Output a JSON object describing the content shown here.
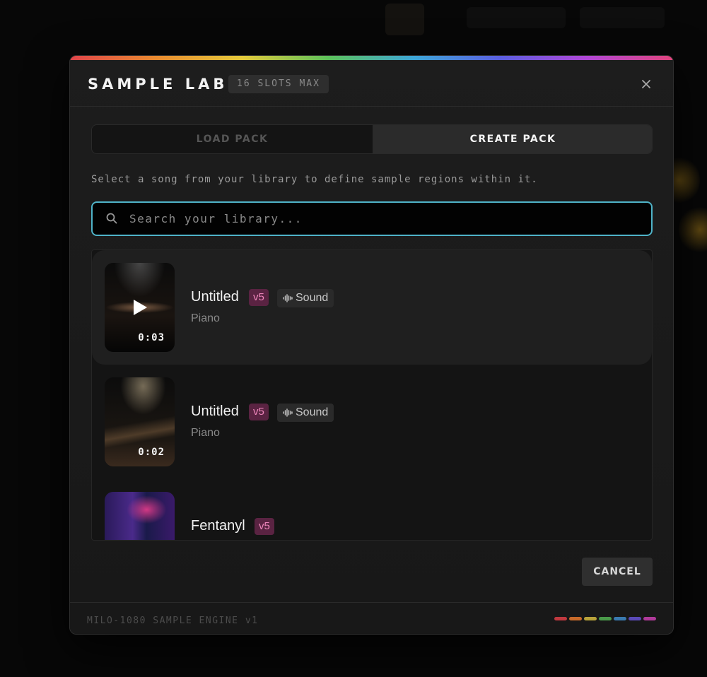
{
  "modal": {
    "title": "SAMPLE LAB",
    "slots_badge": "16 SLOTS MAX",
    "close_icon": "close-icon"
  },
  "tabs": [
    {
      "label": "LOAD PACK",
      "active": false
    },
    {
      "label": "CREATE PACK",
      "active": true
    }
  ],
  "hint": "Select a song from your library to define sample regions within it.",
  "search": {
    "placeholder": "Search your library...",
    "value": ""
  },
  "songs": [
    {
      "title": "Untitled",
      "version": "v5",
      "sound_label": "Sound",
      "genre": "Piano",
      "duration": "0:03",
      "hovered": true
    },
    {
      "title": "Untitled",
      "version": "v5",
      "sound_label": "Sound",
      "genre": "Piano",
      "duration": "0:02",
      "hovered": false
    },
    {
      "title": "Fentanyl",
      "version": "v5"
    }
  ],
  "cancel_label": "CANCEL",
  "footer": {
    "engine_label": "MILO-1080 SAMPLE ENGINE v1",
    "dot_colors": [
      "#c0393f",
      "#c86a2a",
      "#b8a23a",
      "#4a9a4a",
      "#3a7ab0",
      "#5a4ab8",
      "#b03a9a"
    ]
  },
  "colors": {
    "accent_search_border": "#4fb3c8",
    "version_badge_bg": "#5a2342",
    "version_badge_text": "#ee86bb"
  }
}
